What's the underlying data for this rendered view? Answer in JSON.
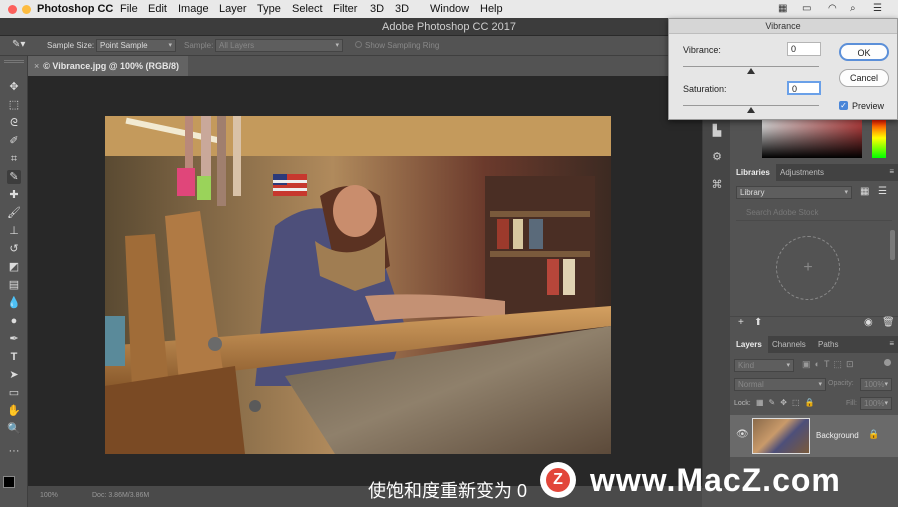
{
  "menubar": {
    "app": "Photoshop CC",
    "items": [
      "File",
      "Edit",
      "Image",
      "Layer",
      "Type",
      "Select",
      "Filter",
      "3D",
      "Window",
      "Help"
    ]
  },
  "window": {
    "title": "Adobe Photoshop CC 2017"
  },
  "options_bar": {
    "sample_size_label": "Sample Size:",
    "sample_size_value": "Point Sample",
    "sample_label": "Sample:",
    "sample_value": "All Layers",
    "show_ring_label": "Show Sampling Ring"
  },
  "document": {
    "tab_label": "© Vibrance.jpg @ 100% (RGB/8)"
  },
  "vibrance_dialog": {
    "title": "Vibrance",
    "vibrance_label": "Vibrance:",
    "vibrance_value": "0",
    "saturation_label": "Saturation:",
    "saturation_value": "0",
    "ok_label": "OK",
    "cancel_label": "Cancel",
    "preview_label": "Preview",
    "preview_checked": true,
    "vibrance_slider_fraction": 0.5,
    "saturation_slider_fraction": 0.5
  },
  "libraries_panel": {
    "tabs": [
      "Libraries",
      "Adjustments"
    ],
    "library_select": "Library",
    "search_placeholder": "Search Adobe Stock"
  },
  "layers_panel": {
    "tabs": [
      "Layers",
      "Channels",
      "Paths"
    ],
    "kind_label": "Kind",
    "blend_mode": "Normal",
    "opacity_label": "Opacity:",
    "opacity_value": "100%",
    "lock_label": "Lock:",
    "fill_label": "Fill:",
    "fill_value": "100%",
    "layers": [
      {
        "name": "Background"
      }
    ]
  },
  "status_bar": {
    "zoom": "100%",
    "doc_size": "Doc: 3.86M/3.86M"
  },
  "caption": {
    "text": "使饱和度重新变为 0",
    "watermark": "www.MacZ.com",
    "logo_letter": "Z"
  },
  "colors": {
    "accent_blue": "#5b8fd8",
    "watermark_red": "#e2463a"
  }
}
